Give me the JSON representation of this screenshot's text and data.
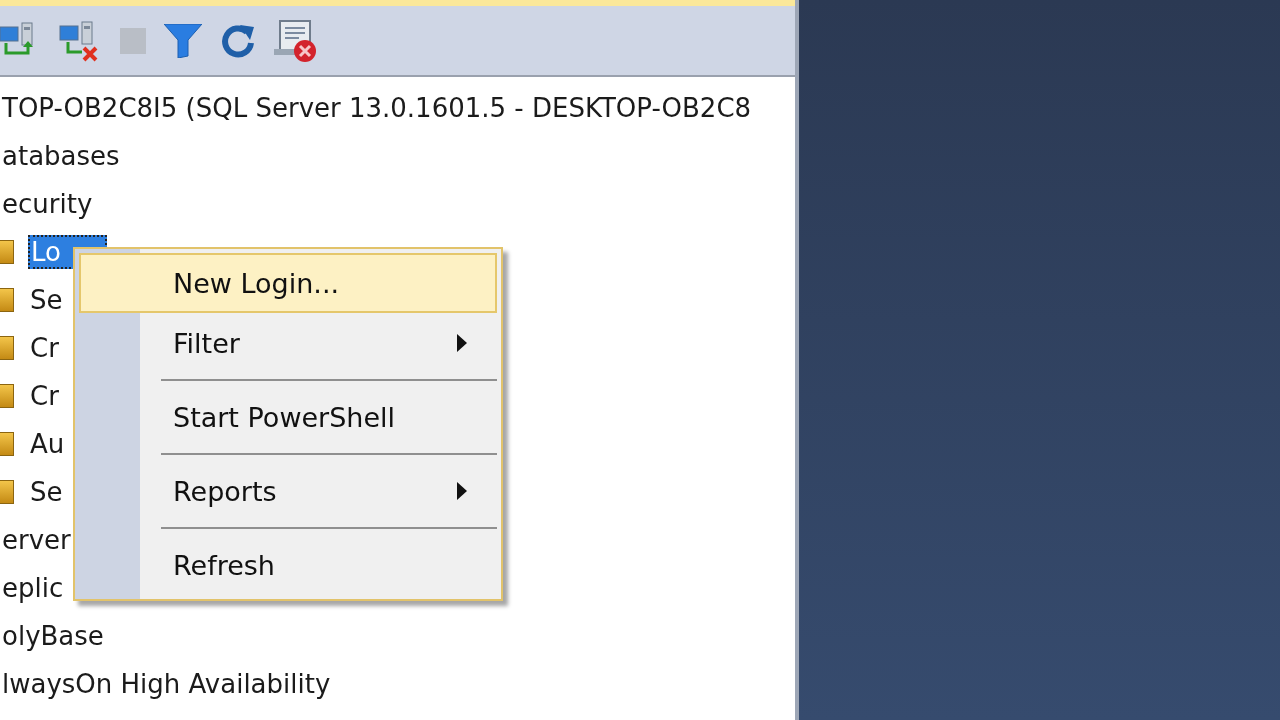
{
  "toolbar": {
    "buttons": [
      {
        "kind": "connect",
        "disabled": false
      },
      {
        "kind": "disconnect",
        "disabled": false
      },
      {
        "kind": "stop",
        "disabled": true
      },
      {
        "kind": "filter",
        "disabled": false
      },
      {
        "kind": "refresh",
        "disabled": false
      },
      {
        "kind": "summary",
        "disabled": false
      }
    ]
  },
  "tree": [
    {
      "label": "TOP-OB2C8I5 (SQL Server 13.0.1601.5 - DESKTOP-OB2C8",
      "selected": false,
      "children": [
        {
          "label": "atabases",
          "selected": false
        },
        {
          "label": "ecurity",
          "selected": false,
          "children": [
            {
              "label": "Lo",
              "kind": "folder",
              "selected": true
            },
            {
              "label": "Se",
              "kind": "folder",
              "selected": false
            },
            {
              "label": "Cr",
              "kind": "folder",
              "selected": false
            },
            {
              "label": "Cr",
              "kind": "folder",
              "selected": false
            },
            {
              "label": "Au",
              "kind": "folder",
              "selected": false
            },
            {
              "label": "Se",
              "kind": "folder",
              "selected": false
            }
          ]
        },
        {
          "label": "erver",
          "selected": false
        },
        {
          "label": "eplic",
          "selected": false
        },
        {
          "label": "olyBase",
          "selected": false
        },
        {
          "label": "lwaysOn High Availability",
          "selected": false
        }
      ]
    }
  ],
  "context_menu": {
    "items": [
      {
        "kind": "item",
        "label": "New Login...",
        "selected": true,
        "submenu": false
      },
      {
        "kind": "item",
        "label": "Filter",
        "selected": false,
        "submenu": true
      },
      {
        "kind": "separator"
      },
      {
        "kind": "item",
        "label": "Start PowerShell",
        "selected": false,
        "submenu": false
      },
      {
        "kind": "separator"
      },
      {
        "kind": "item",
        "label": "Reports",
        "selected": false,
        "submenu": true
      },
      {
        "kind": "separator"
      },
      {
        "kind": "item",
        "label": "Refresh",
        "selected": false,
        "submenu": false
      }
    ]
  }
}
